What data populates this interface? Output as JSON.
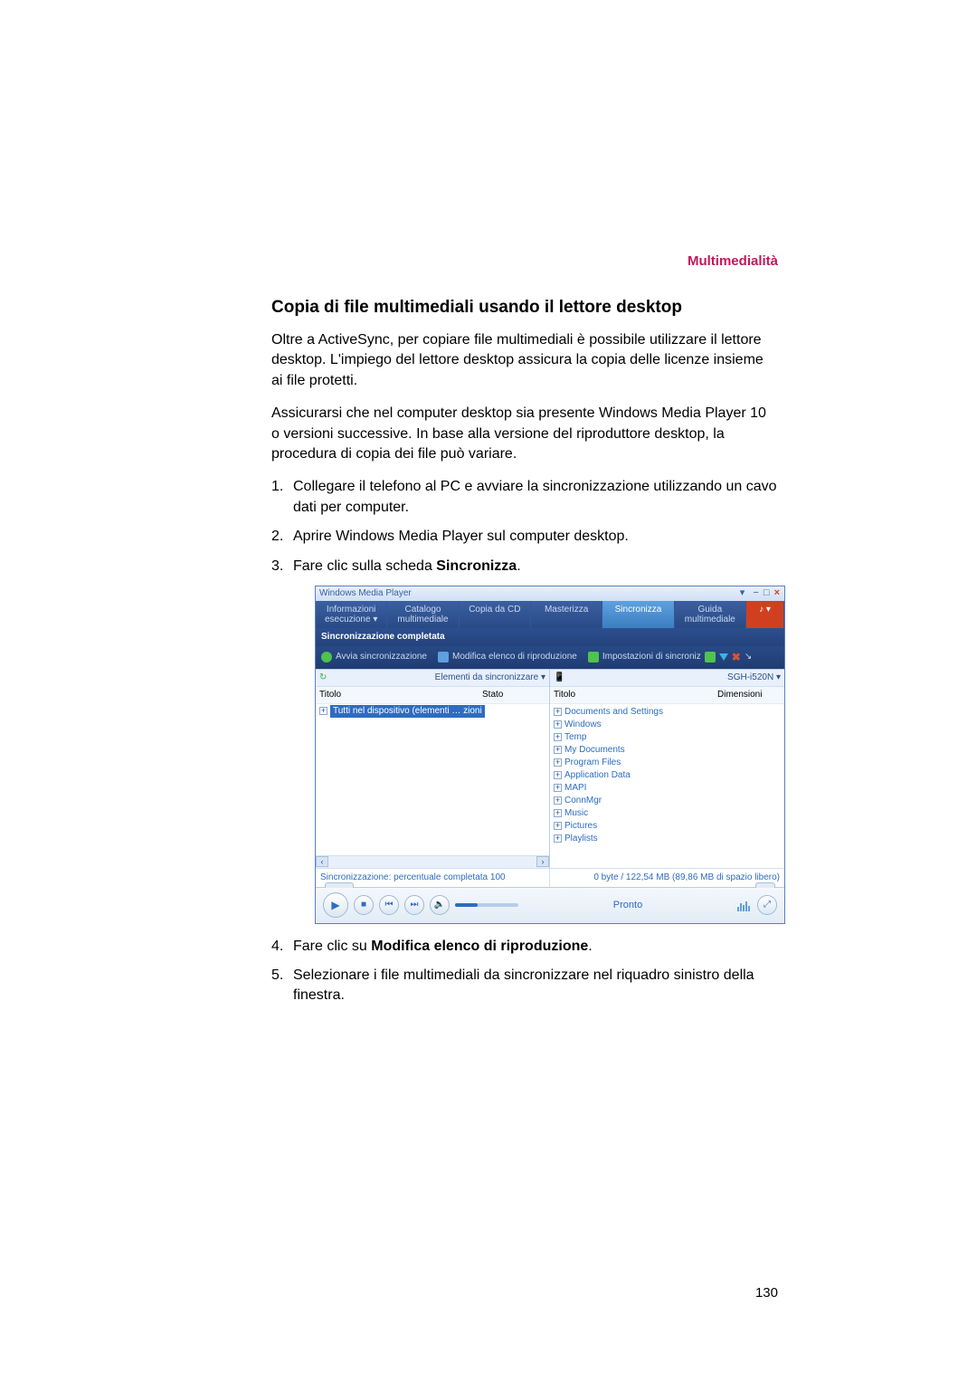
{
  "section_label": "Multimedialità",
  "heading": "Copia di file multimediali usando il lettore desktop",
  "para1": "Oltre a ActiveSync, per copiare file multimediali è possibile utilizzare il lettore desktop. L'impiego del lettore desktop assicura la copia delle licenze insieme ai file protetti.",
  "para2": "Assicurarsi che nel computer desktop sia presente Windows Media Player 10 o versioni successive. In base alla versione del riproduttore desktop, la procedura di copia dei file può variare.",
  "steps": {
    "s1": "Collegare il telefono al PC e avviare la sincronizzazione utilizzando un cavo dati per computer.",
    "s2": "Aprire Windows Media Player sul computer desktop.",
    "s3a": "Fare clic sulla scheda ",
    "s3b_bold": "Sincronizza",
    "s3c": ".",
    "s4a": "Fare clic su ",
    "s4b_bold": "Modifica elenco di riproduzione",
    "s4c": ".",
    "s5": "Selezionare i file multimediali da sincronizzare nel riquadro sinistro della finestra."
  },
  "page_number": "130",
  "wmp": {
    "title": "Windows Media Player",
    "win_ctl": {
      "min": "−",
      "max": "□",
      "close": "×"
    },
    "tabs": {
      "t1a": "Informazioni",
      "t1b": "esecuzione",
      "t2a": "Catalogo",
      "t2b": "multimediale",
      "t3": "Copia da CD",
      "t4": "Masterizza",
      "t5": "Sincronizza",
      "t6a": "Guida",
      "t6b": "multimediale",
      "t7": "♪"
    },
    "subbar": "Sincronizzazione completata",
    "toolbar": {
      "a": "Avvia sincronizzazione",
      "b": "Modifica elenco di riproduzione",
      "c": "Impostazioni di sincroniz"
    },
    "left": {
      "head": "Elementi da sincronizzare",
      "col1": "Titolo",
      "col2": "Stato",
      "item": "Tutti nel dispositivo (elementi … zioni"
    },
    "right": {
      "head": "SGH-i520N",
      "col1": "Titolo",
      "col2": "Dimensioni",
      "tree": [
        "Documents and Settings",
        "Windows",
        "Temp",
        "My Documents",
        "Program Files",
        "Application Data",
        "MAPI",
        "ConnMgr",
        "Music",
        "Pictures",
        "Playlists"
      ]
    },
    "status_left": "Sincronizzazione: percentuale completata 100",
    "status_right": "0 byte / 122,54 MB (89,86 MB di spazio libero)",
    "ready": "Pronto",
    "pbtns": {
      "play": "▶",
      "stop": "■",
      "prev": "⏮",
      "next": "⏭",
      "mute": "🔈",
      "full": "⤢"
    }
  }
}
